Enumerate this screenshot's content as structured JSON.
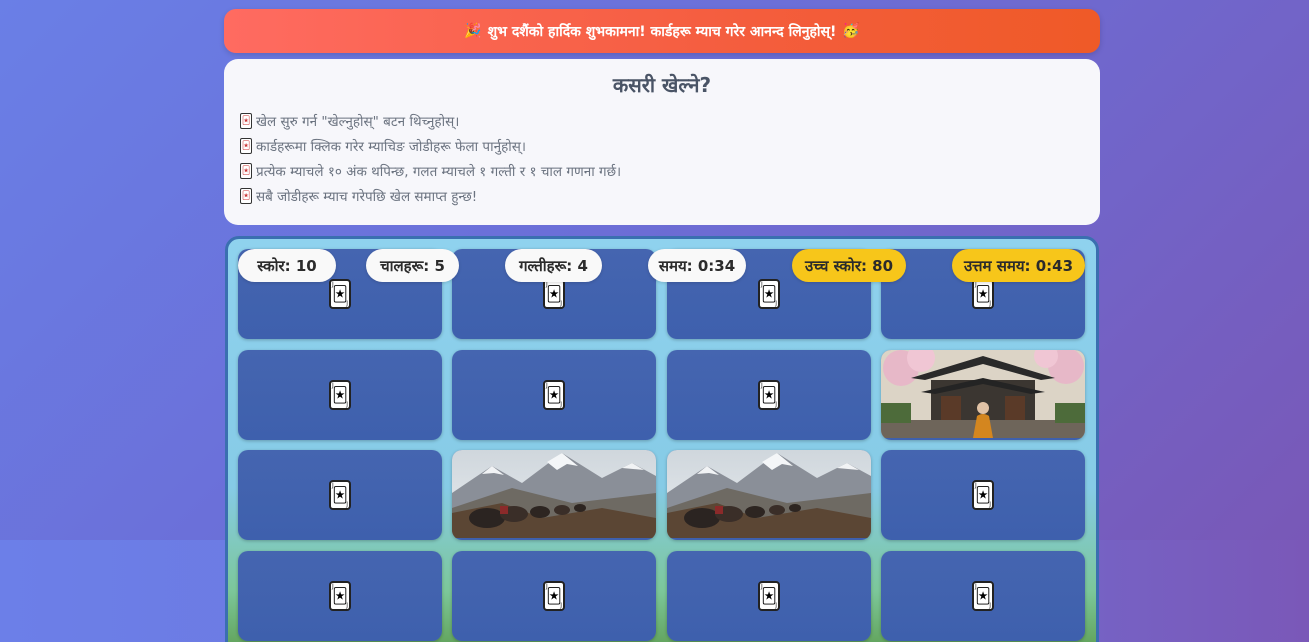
{
  "banner": {
    "text": "शुभ दशैंको हार्दिक शुभकामना! कार्डहरू म्याच गरेर आनन्द लिनुहोस्!",
    "left_icon": "party-popper-icon",
    "right_icon": "star-struck-face-icon"
  },
  "howto": {
    "title": "कसरी खेल्ने?",
    "items": [
      "खेल सुरु गर्न \"खेल्नुहोस्\" बटन थिच्नुहोस्।",
      "कार्डहरूमा क्लिक गरेर म्याचिङ जोडीहरू फेला पार्नुहोस्।",
      "प्रत्येक म्याचले १० अंक थपिन्छ, गलत म्याचले १ गल्ती र १ चाल गणना गर्छ।",
      "सबै जोडीहरू म्याच गरेपछि खेल समाप्त हुन्छ!"
    ],
    "bullet_icon": "playing-card-icon"
  },
  "stats": {
    "score": "स्कोर: 10",
    "moves": "चालहरू: 5",
    "mistakes": "गल्तीहरू: 4",
    "time": "समय: 0:34",
    "high_score": "उच्च स्कोर: 80",
    "best_time": "उत्तम समय: 0:43"
  },
  "board": {
    "columns": 4,
    "cards": [
      {
        "state": "face-down"
      },
      {
        "state": "face-down"
      },
      {
        "state": "face-down"
      },
      {
        "state": "face-down"
      },
      {
        "state": "face-down"
      },
      {
        "state": "face-down"
      },
      {
        "state": "face-down"
      },
      {
        "state": "face-up",
        "image": "monastery-monk"
      },
      {
        "state": "face-down"
      },
      {
        "state": "face-up",
        "image": "mountain-yaks"
      },
      {
        "state": "face-up",
        "image": "mountain-yaks"
      },
      {
        "state": "face-down"
      },
      {
        "state": "face-down"
      },
      {
        "state": "face-down"
      },
      {
        "state": "face-down"
      },
      {
        "state": "face-down"
      }
    ]
  },
  "colors": {
    "banner": "#f45d3d",
    "card_back": "#4163af",
    "gold_badge": "#f7c61a"
  }
}
